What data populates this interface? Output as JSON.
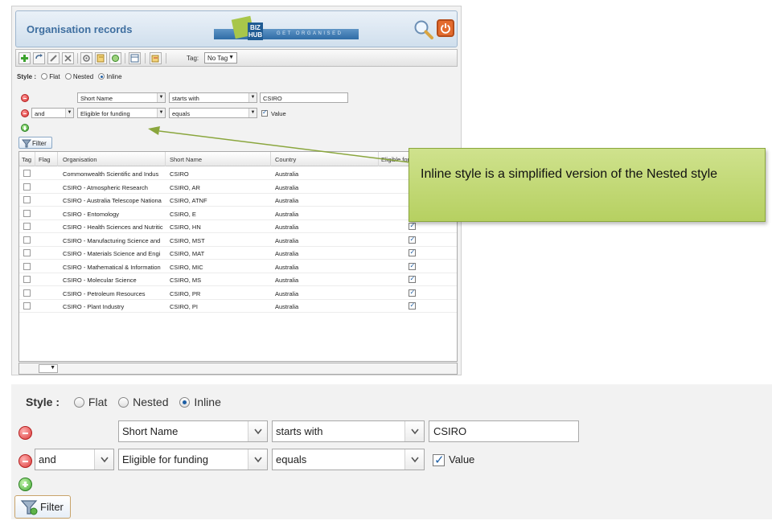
{
  "app": {
    "title": "Organisation records",
    "brand_logo": "BIZ HUB",
    "brand_tagline": "GET ORGANISED"
  },
  "toolbar": {
    "tag_label": "Tag:",
    "tag_value": "No Tag"
  },
  "filter": {
    "style_label": "Style :",
    "style_options": [
      "Flat",
      "Nested",
      "Inline"
    ],
    "style_selected": "Inline",
    "row1": {
      "field": "Short Name",
      "operator": "starts with",
      "value": "CSIRO"
    },
    "row2": {
      "conjunction": "and",
      "field": "Eligible for funding",
      "operator": "equals",
      "value_label": "Value",
      "value_checked": true
    },
    "filter_button": "Filter"
  },
  "grid": {
    "columns": [
      "Tag",
      "Flag",
      "Organisation",
      "Short Name",
      "Country",
      "Eligible for"
    ],
    "rows": [
      {
        "organisation": "Commonwealth Scientific and Indus",
        "short_name": "CSIRO",
        "country": "Australia",
        "eligible": true
      },
      {
        "organisation": "CSIRO - Atmospheric Research",
        "short_name": "CSIRO, AR",
        "country": "Australia",
        "eligible": true
      },
      {
        "organisation": "CSIRO - Australia Telescope Nationa",
        "short_name": "CSIRO, ATNF",
        "country": "Australia",
        "eligible": true
      },
      {
        "organisation": "CSIRO - Entomology",
        "short_name": "CSIRO, E",
        "country": "Australia",
        "eligible": true
      },
      {
        "organisation": "CSIRO - Health Sciences and Nutritic",
        "short_name": "CSIRO, HN",
        "country": "Australia",
        "eligible": true
      },
      {
        "organisation": "CSIRO - Manufacturing Science and",
        "short_name": "CSIRO, MST",
        "country": "Australia",
        "eligible": true
      },
      {
        "organisation": "CSIRO - Materials Science and Engi",
        "short_name": "CSIRO, MAT",
        "country": "Australia",
        "eligible": true
      },
      {
        "organisation": "CSIRO - Mathematical & Information",
        "short_name": "CSIRO, MIC",
        "country": "Australia",
        "eligible": true
      },
      {
        "organisation": "CSIRO - Molecular Science",
        "short_name": "CSIRO, MS",
        "country": "Australia",
        "eligible": true
      },
      {
        "organisation": "CSIRO - Petroleum Resources",
        "short_name": "CSIRO, PR",
        "country": "Australia",
        "eligible": true
      },
      {
        "organisation": "CSIRO - Plant Industry",
        "short_name": "CSIRO, PI",
        "country": "Australia",
        "eligible": true
      }
    ]
  },
  "callout": {
    "text": "Inline style is a simplified version of the Nested style"
  },
  "colors": {
    "accent_blue": "#3f6fa0",
    "callout_green": "#b6d061",
    "remove_red": "#dc3a3a",
    "add_green": "#45ab35"
  }
}
